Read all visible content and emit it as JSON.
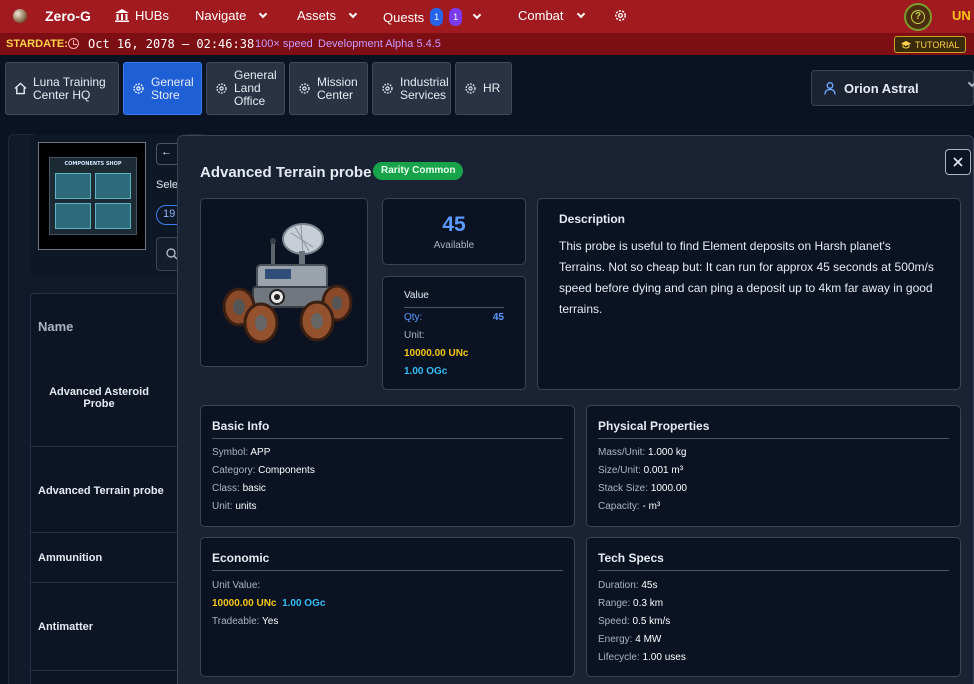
{
  "topnav": {
    "brand": "Zero-G",
    "hubs": "HUBs",
    "navigate": "Navigate",
    "assets": "Assets",
    "quests": "Quests",
    "quest_badge_blue": "1",
    "quest_badge_purple": "1",
    "combat": "Combat",
    "currency_short": "UN"
  },
  "stardate": {
    "label": "STARDATE:",
    "datetime": "Oct 16, 2078 — 02:46:38",
    "speed": "100× speed",
    "version": "Development Alpha 5.4.5",
    "tutorial": "TUTORIAL"
  },
  "tabs": [
    {
      "label": "Luna Training Center HQ",
      "icon": "home-icon"
    },
    {
      "label": "General Store",
      "icon": "gear-icon"
    },
    {
      "label": "General Land Office",
      "icon": "gear-icon"
    },
    {
      "label": "Mission Center",
      "icon": "gear-icon"
    },
    {
      "label": "Industrial Services",
      "icon": "gear-icon"
    },
    {
      "label": "HR",
      "icon": "gear-icon"
    }
  ],
  "user": {
    "name": "Orion Astral"
  },
  "store": {
    "shop_image_label": "COMPONENTS SHOP",
    "back": "←",
    "select_text": "Selec",
    "count_pill": "19"
  },
  "list": {
    "header": "Name",
    "items": [
      "Advanced Asteroid Probe",
      "Advanced Terrain probe",
      "Ammunition",
      "Antimatter"
    ]
  },
  "modal": {
    "title": "Advanced Terrain probe",
    "rarity": "Rarity Common",
    "available_count": "45",
    "available_label": "Available",
    "value": {
      "heading": "Value",
      "qty_label": "Qty:",
      "qty": "45",
      "unit_label": "Unit:",
      "unc": "10000.00 UNc",
      "ogc": "1.00 OGc"
    },
    "description": {
      "heading": "Description",
      "text": "This probe is useful to find Element deposits on Harsh planet's Terrains. Not so cheap but: It can run for approx 45 seconds at 500m/s speed before dying and can ping a deposit up to 4km far away in good terrains."
    },
    "basic_info": {
      "heading": "Basic Info",
      "rows": [
        {
          "k": "Symbol:",
          "v": "APP"
        },
        {
          "k": "Category:",
          "v": "Components"
        },
        {
          "k": "Class:",
          "v": "basic"
        },
        {
          "k": "Unit:",
          "v": "units"
        }
      ]
    },
    "physical": {
      "heading": "Physical Properties",
      "rows": [
        {
          "k": "Mass/Unit:",
          "v": "1.000 kg"
        },
        {
          "k": "Size/Unit:",
          "v": "0.001 m³"
        },
        {
          "k": "Stack Size:",
          "v": "1000.00"
        },
        {
          "k": "Capacity:",
          "v": "- m³"
        }
      ]
    },
    "economic": {
      "heading": "Economic",
      "unit_value_label": "Unit Value:",
      "unc": "10000.00 UNc",
      "ogc": "1.00 OGc",
      "tradeable_label": "Tradeable:",
      "tradeable": "Yes"
    },
    "tech": {
      "heading": "Tech Specs",
      "rows": [
        {
          "k": "Duration:",
          "v": "45s"
        },
        {
          "k": "Range:",
          "v": "0.3 km"
        },
        {
          "k": "Speed:",
          "v": "0.5 km/s"
        },
        {
          "k": "Energy:",
          "v": "4 MW"
        },
        {
          "k": "Lifecycle:",
          "v": "1.00 uses"
        }
      ]
    }
  }
}
